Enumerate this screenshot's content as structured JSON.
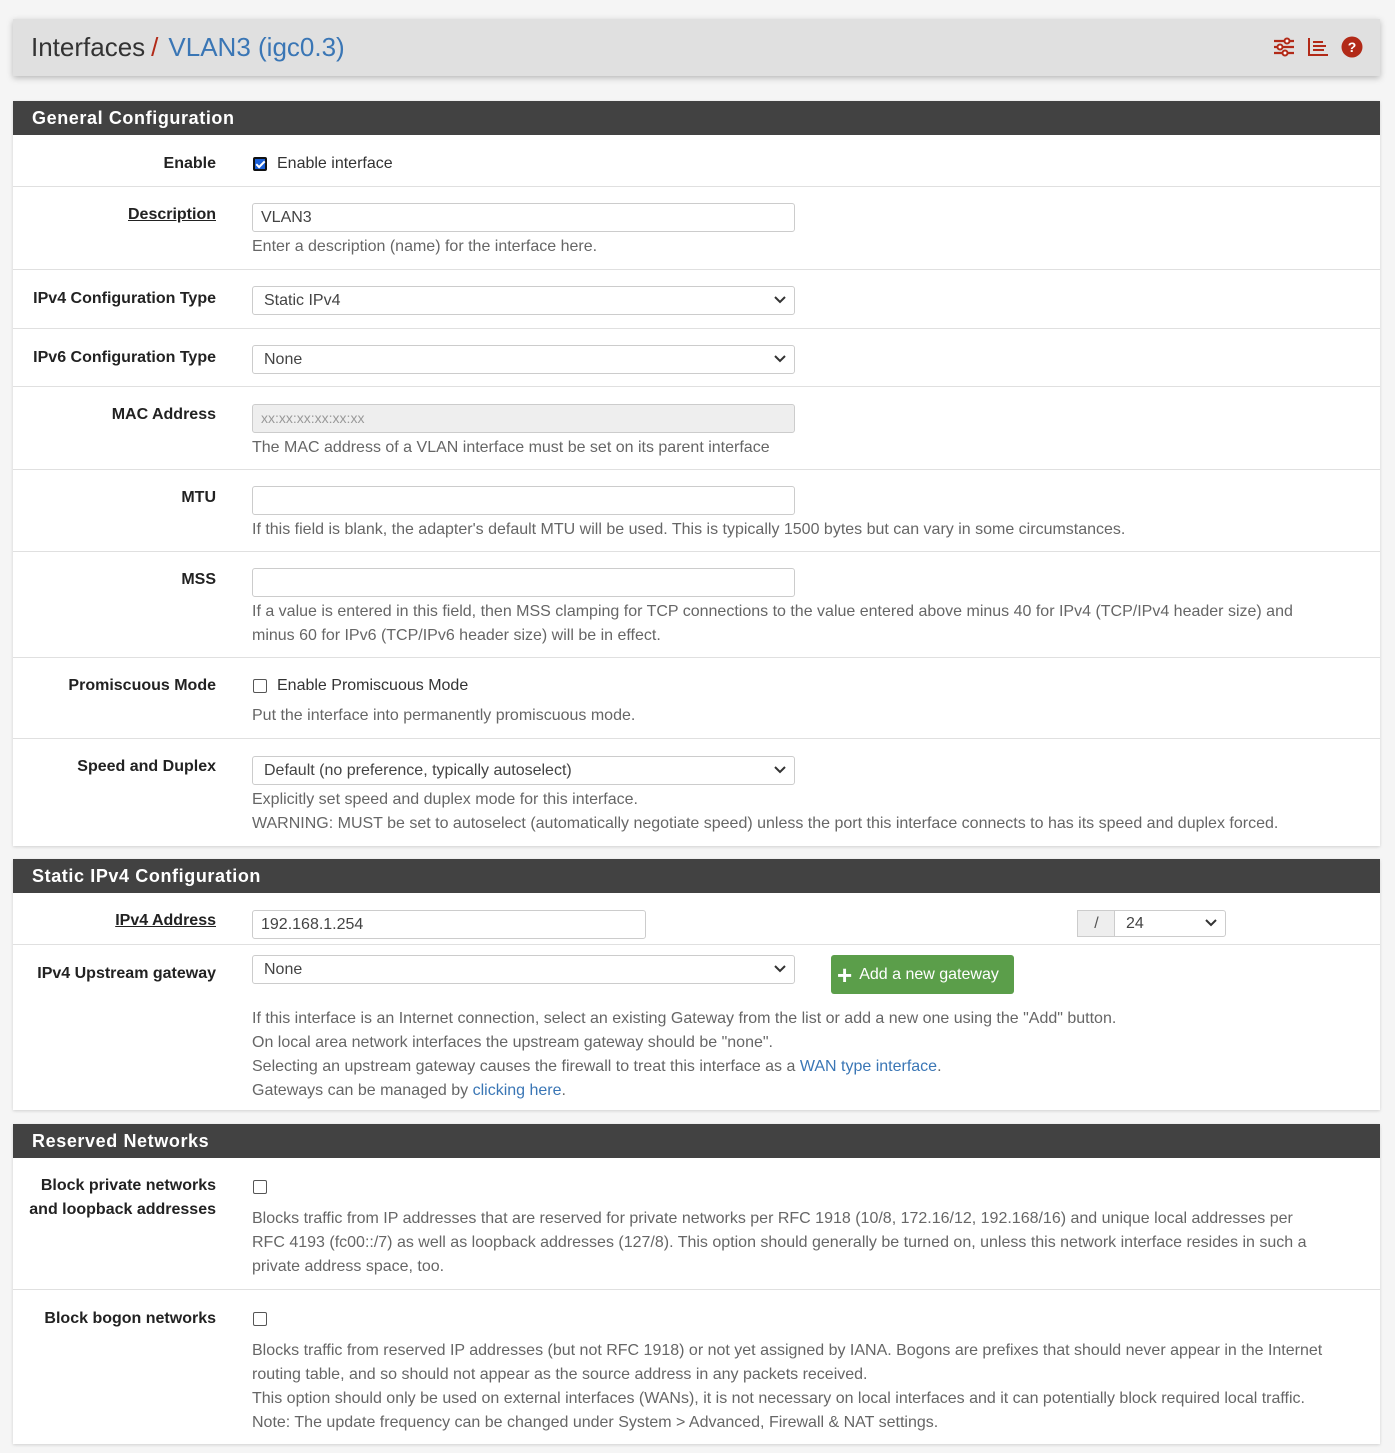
{
  "header": {
    "breadcrumb_root": "Interfaces",
    "breadcrumb_separator": "/",
    "breadcrumb_current": "VLAN3 (igc0.3)",
    "icons": [
      "settings-sliders-icon",
      "log-chart-icon",
      "help-icon"
    ],
    "accent_color": "#b22a18",
    "link_color": "#3a76b5"
  },
  "general": {
    "title": "General Configuration",
    "enable": {
      "label": "Enable",
      "checkbox_label": "Enable interface",
      "checked": true
    },
    "description": {
      "label": "Description",
      "value": "VLAN3",
      "help": "Enter a description (name) for the interface here."
    },
    "ipv4_type": {
      "label": "IPv4 Configuration Type",
      "value": "Static IPv4"
    },
    "ipv6_type": {
      "label": "IPv6 Configuration Type",
      "value": "None"
    },
    "mac": {
      "label": "MAC Address",
      "placeholder": "xx:xx:xx:xx:xx:xx",
      "help": "The MAC address of a VLAN interface must be set on its parent interface"
    },
    "mtu": {
      "label": "MTU",
      "value": "",
      "help": "If this field is blank, the adapter's default MTU will be used. This is typically 1500 bytes but can vary in some circumstances."
    },
    "mss": {
      "label": "MSS",
      "value": "",
      "help_line1": "If a value is entered in this field, then MSS clamping for TCP connections to the value entered above minus 40 for IPv4 (TCP/IPv4 header size) and",
      "help_line2": "minus 60 for IPv6 (TCP/IPv6 header size) will be in effect."
    },
    "promisc": {
      "label": "Promiscuous Mode",
      "checkbox_label": "Enable Promiscuous Mode",
      "checked": false,
      "help": "Put the interface into permanently promiscuous mode."
    },
    "speed": {
      "label": "Speed and Duplex",
      "value": "Default (no preference, typically autoselect)",
      "help_line1": "Explicitly set speed and duplex mode for this interface.",
      "help_line2": "WARNING: MUST be set to autoselect (automatically negotiate speed) unless the port this interface connects to has its speed and duplex forced."
    }
  },
  "static_ipv4": {
    "title": "Static IPv4 Configuration",
    "address": {
      "label": "IPv4 Address",
      "value": "192.168.1.254",
      "slash": "/",
      "cidr": "24"
    },
    "gateway": {
      "label": "IPv4 Upstream gateway",
      "value": "None",
      "add_button": "Add a new gateway",
      "add_button_color": "#5b9e4a",
      "help_line1": "If this interface is an Internet connection, select an existing Gateway from the list or add a new one using the \"Add\" button.",
      "help_line2": "On local area network interfaces the upstream gateway should be \"none\".",
      "help_line3_pre": "Selecting an upstream gateway causes the firewall to treat this interface as a ",
      "help_line3_link": "WAN type interface",
      "help_line3_post": ".",
      "help_line4_pre": "Gateways can be managed by ",
      "help_line4_link": "clicking here",
      "help_line4_post": "."
    }
  },
  "reserved": {
    "title": "Reserved Networks",
    "block_private": {
      "label_line1": "Block private networks",
      "label_line2": "and loopback addresses",
      "checked": false,
      "help_line1": "Blocks traffic from IP addresses that are reserved for private networks per RFC 1918 (10/8, 172.16/12, 192.168/16) and unique local addresses per",
      "help_line2": "RFC 4193 (fc00::/7) as well as loopback addresses (127/8). This option should generally be turned on, unless this network interface resides in such a",
      "help_line3": "private address space, too."
    },
    "block_bogon": {
      "label": "Block bogon networks",
      "checked": false,
      "help_line1": "Blocks traffic from reserved IP addresses (but not RFC 1918) or not yet assigned by IANA. Bogons are prefixes that should never appear in the Internet",
      "help_line2": "routing table, and so should not appear as the source address in any packets received.",
      "help_line3": "This option should only be used on external interfaces (WANs), it is not necessary on local interfaces and it can potentially block required local traffic.",
      "help_line4": "Note: The update frequency can be changed under System > Advanced, Firewall & NAT settings."
    }
  }
}
